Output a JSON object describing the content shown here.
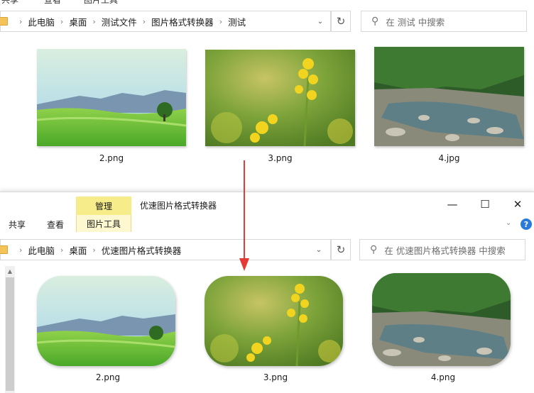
{
  "window_back": {
    "top_strip_fragments": [
      "共享",
      "查看",
      "图片工具"
    ],
    "breadcrumb": [
      "此电脑",
      "桌面",
      "测试文件",
      "图片格式转换器",
      "测试"
    ],
    "search_placeholder": "在 测试 中搜索",
    "files": [
      {
        "name": "2.png",
        "scene": "meadow"
      },
      {
        "name": "3.png",
        "scene": "flower"
      },
      {
        "name": "4.jpg",
        "scene": "river"
      }
    ]
  },
  "window_front": {
    "context_tab": "管理",
    "context_subtab": "图片工具",
    "ribbon_tabs": [
      "共享",
      "查看"
    ],
    "title": "优速图片格式转换器",
    "controls": {
      "minimize": "—",
      "maximize": "☐",
      "close": "✕"
    },
    "help_label": "?",
    "breadcrumb": [
      "此电脑",
      "桌面",
      "优速图片格式转换器"
    ],
    "search_placeholder": "在 优速图片格式转换器 中搜索",
    "files": [
      {
        "name": "2.png",
        "scene": "meadow"
      },
      {
        "name": "3.png",
        "scene": "flower"
      },
      {
        "name": "4.png",
        "scene": "river"
      }
    ]
  },
  "icons": {
    "chevron": "›",
    "dropdown": "⌄",
    "refresh": "↻",
    "search": "⚲"
  },
  "colors": {
    "arrow": "#e53935",
    "context_tab": "#f7ec8a",
    "help": "#2b79d8",
    "folder": "#f3c35a"
  }
}
